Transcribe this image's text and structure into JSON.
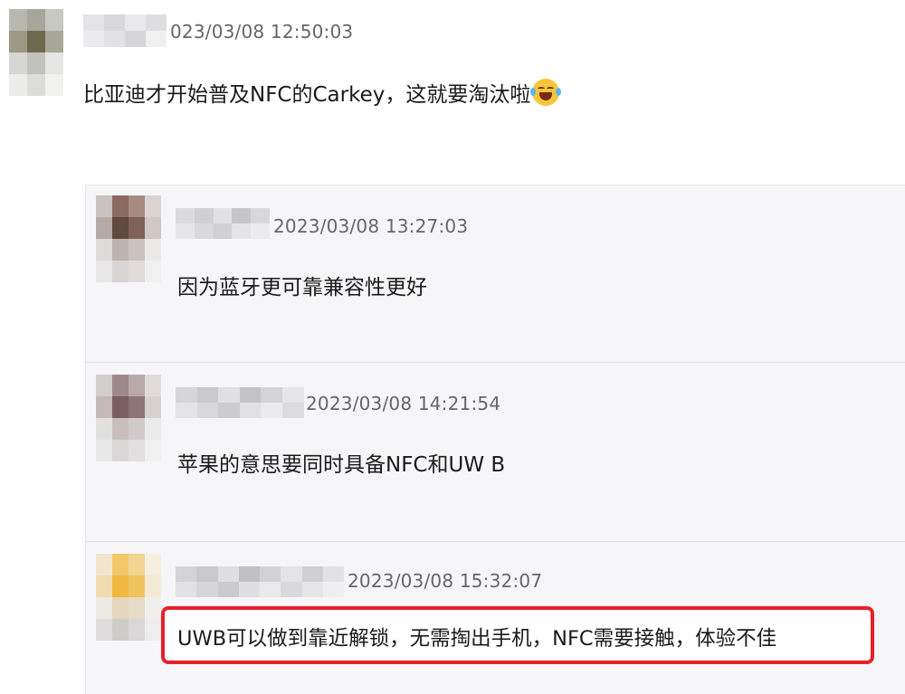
{
  "comments": [
    {
      "timestamp": "023/03/08 12:50:03",
      "text": "比亚迪才开始普及NFC的Carkey，这就要淘汰啦",
      "emoji": "laughing-tears-emoji"
    }
  ],
  "replies": [
    {
      "timestamp": "2023/03/08 13:27:03",
      "text": "因为蓝牙更可靠兼容性更好"
    },
    {
      "timestamp": "2023/03/08 14:21:54",
      "text": "苹果的意思要同时具备NFC和UW B"
    },
    {
      "timestamp": "2023/03/08 15:32:07",
      "text": "UWB可以做到靠近解锁，无需掏出手机，NFC需要接触，体验不佳"
    }
  ],
  "colors": {
    "highlight": "#e8202a",
    "reply_background": "#f6f6f8",
    "timestamp": "#666666"
  }
}
